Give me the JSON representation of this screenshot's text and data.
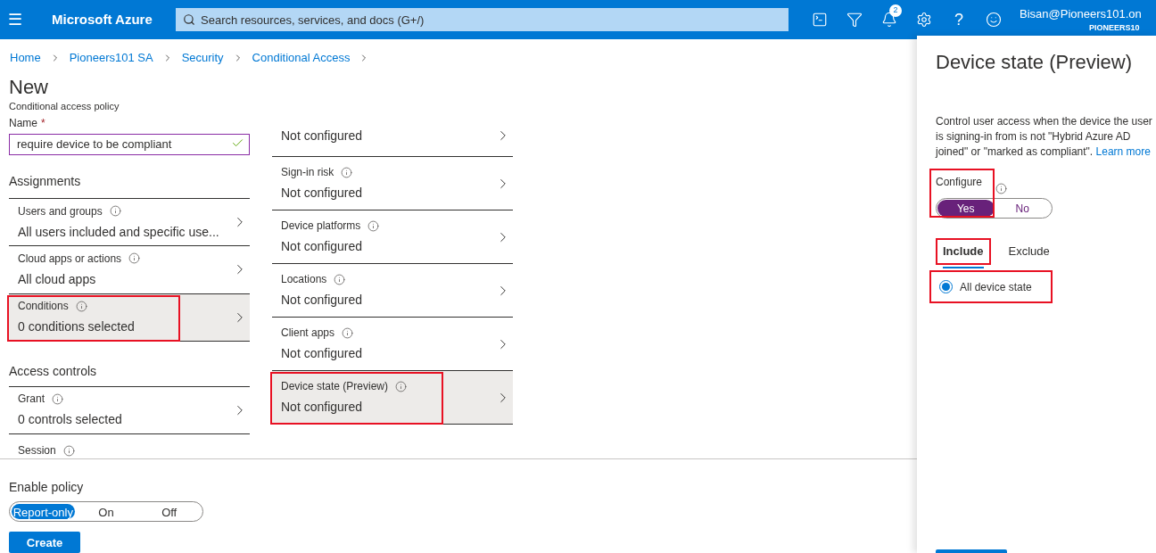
{
  "topbar": {
    "menu_label": "☰",
    "brand": "Microsoft Azure",
    "search": {
      "placeholder": "Search resources, services, and docs (G+/)"
    },
    "notification_count": "2",
    "help_glyph": "?",
    "account": {
      "user": "Bisan@Pioneers101.on",
      "tenant": "PIONEERS10"
    }
  },
  "breadcrumb": [
    {
      "label": "Home"
    },
    {
      "label": "Pioneers101 SA"
    },
    {
      "label": "Security"
    },
    {
      "label": "Conditional Access"
    }
  ],
  "page": {
    "title": "New",
    "subtitle": "Conditional access policy"
  },
  "name_field": {
    "label": "Name",
    "required_mark": "*",
    "value": "require device to be compliant",
    "valid": true
  },
  "assignments": {
    "heading": "Assignments",
    "items": [
      {
        "label": "Users and groups",
        "value": "All users included and specific use...",
        "highlighted": false,
        "selected": false
      },
      {
        "label": "Cloud apps or actions",
        "value": "All cloud apps",
        "highlighted": false,
        "selected": false
      },
      {
        "label": "Conditions",
        "value": "0 conditions selected",
        "highlighted": true,
        "selected": true
      }
    ]
  },
  "access_controls": {
    "heading": "Access controls",
    "items": [
      {
        "label": "Grant",
        "value": "0 controls selected",
        "highlighted": false,
        "selected": false
      }
    ],
    "cut_item": {
      "label": "Session"
    }
  },
  "conditions": [
    {
      "value": "Not configured",
      "highlighted": false,
      "selected": false
    },
    {
      "label": "Sign-in risk",
      "value": "Not configured",
      "highlighted": false,
      "selected": false
    },
    {
      "label": "Device platforms",
      "value": "Not configured",
      "highlighted": false,
      "selected": false
    },
    {
      "label": "Locations",
      "value": "Not configured",
      "highlighted": false,
      "selected": false
    },
    {
      "label": "Client apps",
      "value": "Not configured",
      "highlighted": false,
      "selected": false
    },
    {
      "label": "Device state (Preview)",
      "value": "Not configured",
      "highlighted": true,
      "selected": true
    }
  ],
  "enable_policy": {
    "label": "Enable policy",
    "options": [
      {
        "label": "Report-only",
        "selected": true
      },
      {
        "label": "On",
        "selected": false
      },
      {
        "label": "Off",
        "selected": false
      }
    ]
  },
  "create_button": "Create",
  "panel": {
    "title": "Device state (Preview)",
    "description": "Control user access when the device the user is signing-in from is not \"Hybrid Azure AD joined\" or \"marked as compliant\".",
    "link": "Learn more",
    "configure": {
      "label": "Configure",
      "highlighted": true,
      "options": [
        {
          "label": "Yes",
          "selected": true
        },
        {
          "label": "No",
          "selected": false
        }
      ]
    },
    "tabs": [
      {
        "label": "Include",
        "selected": true,
        "highlighted": true
      },
      {
        "label": "Exclude",
        "selected": false,
        "highlighted": false
      }
    ],
    "radios": [
      {
        "label": "All device state",
        "selected": true,
        "highlighted": true
      }
    ]
  }
}
